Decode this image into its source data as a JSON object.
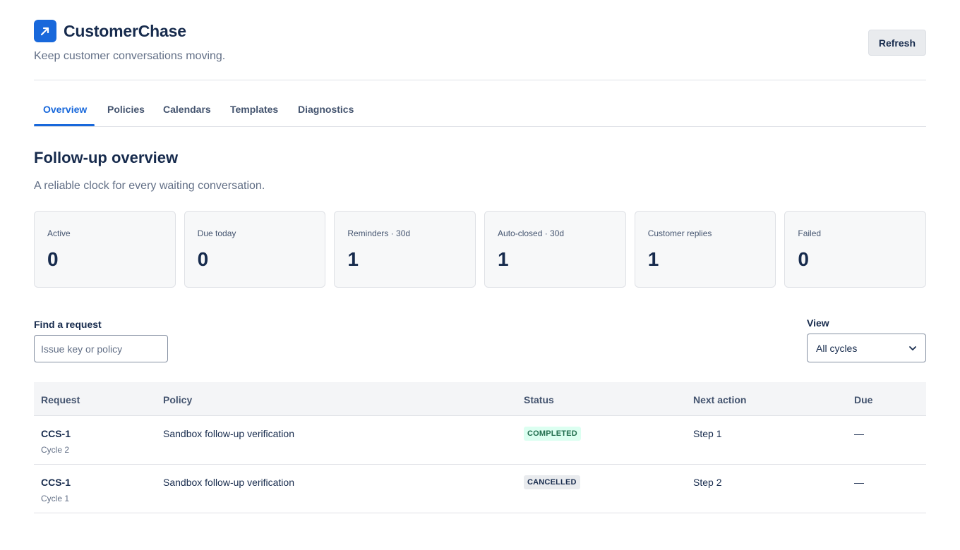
{
  "app": {
    "name": "CustomerChase",
    "tagline": "Keep customer conversations moving.",
    "refresh_label": "Refresh",
    "accent_color": "#1868db"
  },
  "tabs": [
    {
      "label": "Overview",
      "active": true
    },
    {
      "label": "Policies",
      "active": false
    },
    {
      "label": "Calendars",
      "active": false
    },
    {
      "label": "Templates",
      "active": false
    },
    {
      "label": "Diagnostics",
      "active": false
    }
  ],
  "overview": {
    "title": "Follow-up overview",
    "subtitle": "A reliable clock for every waiting conversation."
  },
  "stats": [
    {
      "label": "Active",
      "value": "0"
    },
    {
      "label": "Due today",
      "value": "0"
    },
    {
      "label": "Reminders · 30d",
      "value": "1"
    },
    {
      "label": "Auto-closed · 30d",
      "value": "1"
    },
    {
      "label": "Customer replies",
      "value": "1"
    },
    {
      "label": "Failed",
      "value": "0"
    }
  ],
  "filters": {
    "find_label": "Find a request",
    "find_placeholder": "Issue key or policy",
    "find_value": "",
    "view_label": "View",
    "view_selected": "All cycles"
  },
  "table": {
    "columns": [
      "Request",
      "Policy",
      "Status",
      "Next action",
      "Due"
    ],
    "rows": [
      {
        "key": "CCS-1",
        "cycle": "Cycle 2",
        "policy": "Sandbox follow-up verification",
        "status": "COMPLETED",
        "next_action": "Step 1",
        "due": "—"
      },
      {
        "key": "CCS-1",
        "cycle": "Cycle 1",
        "policy": "Sandbox follow-up verification",
        "status": "CANCELLED",
        "next_action": "Step 2",
        "due": "—"
      }
    ]
  }
}
